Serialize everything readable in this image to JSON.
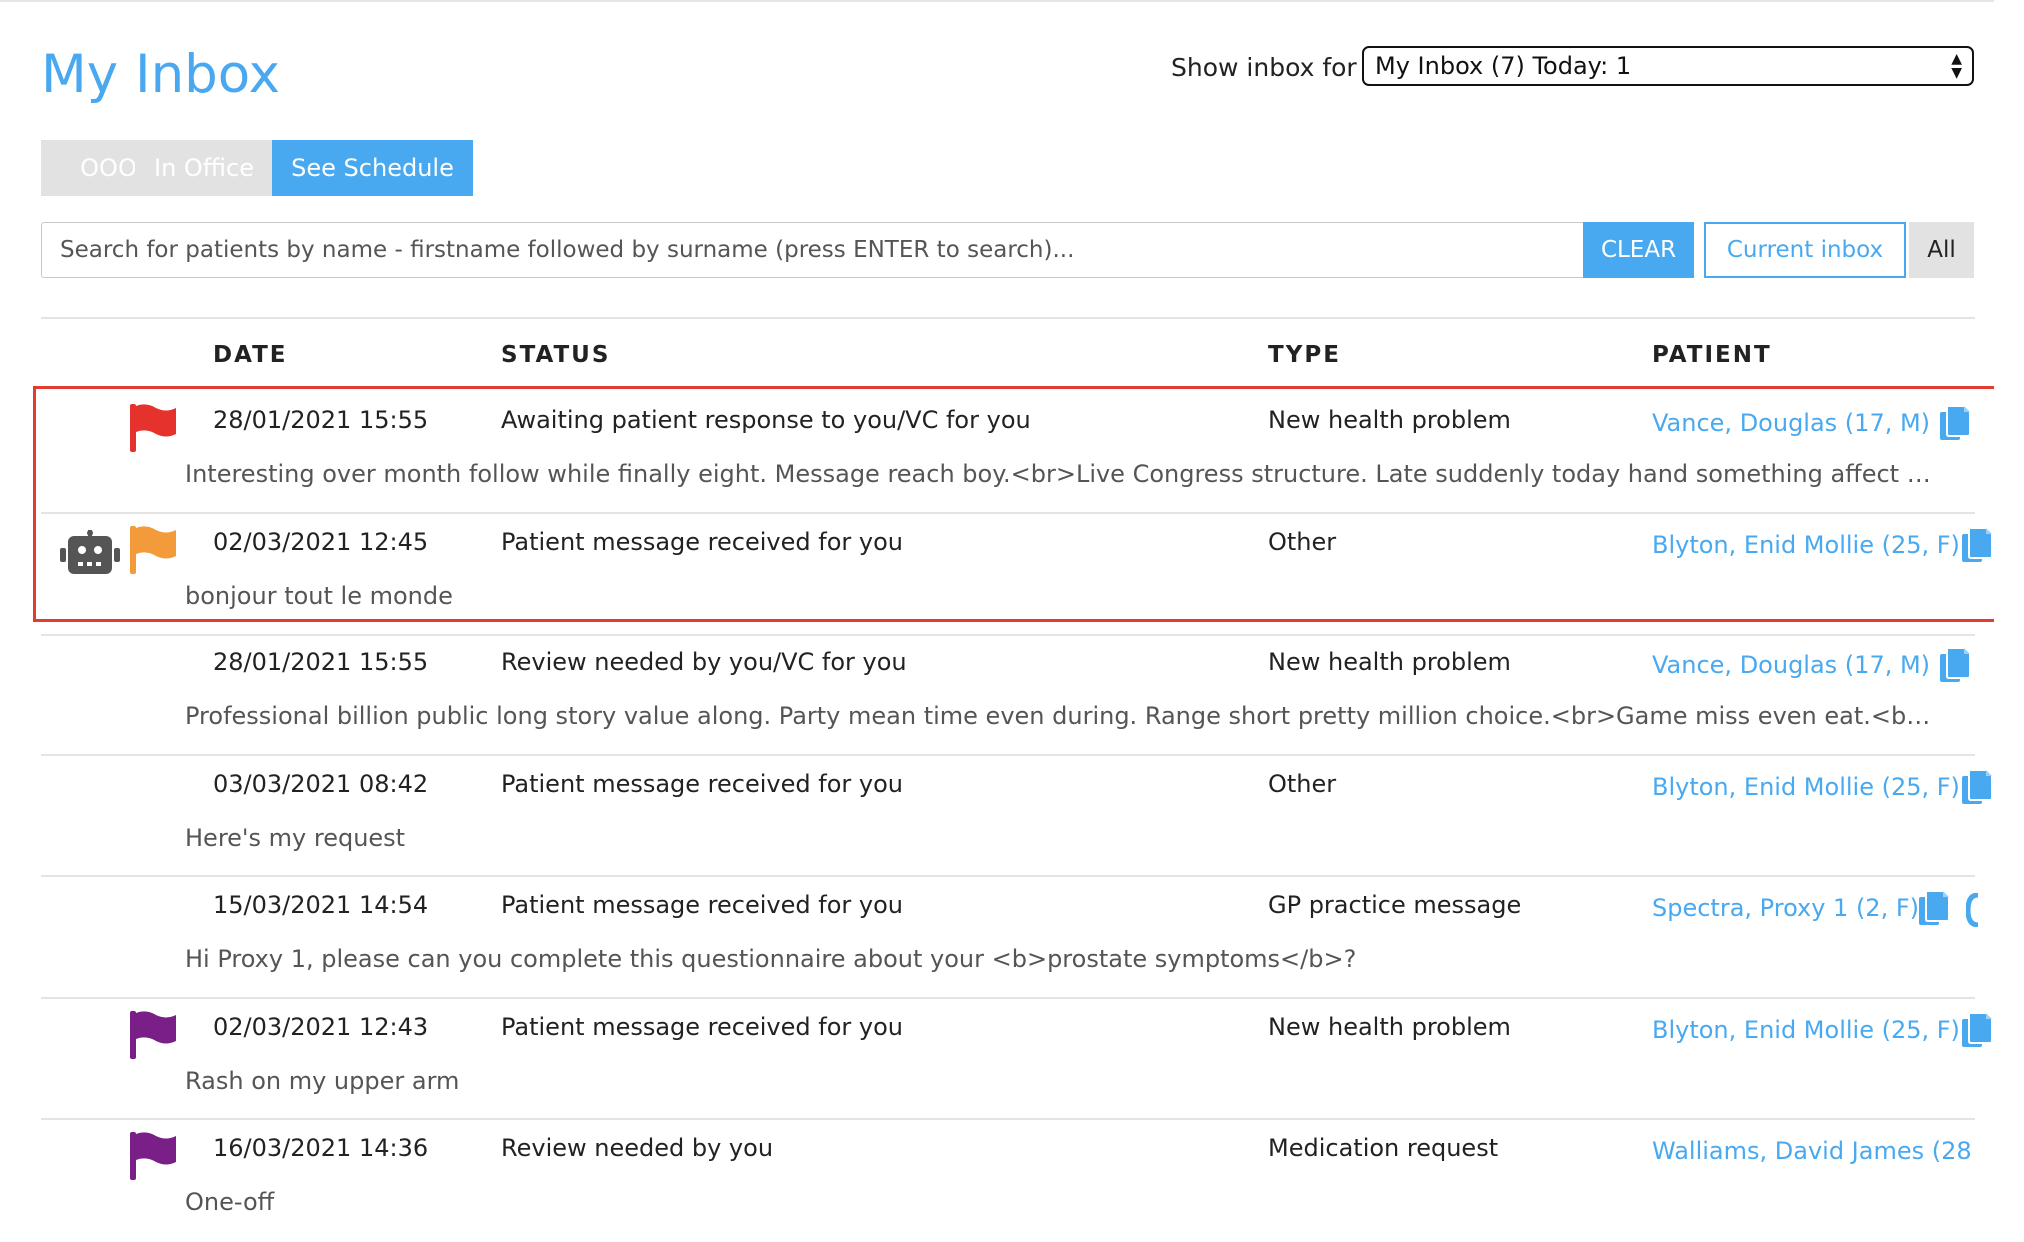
{
  "header": {
    "title": "My Inbox",
    "show_inbox_label": "Show inbox for",
    "inbox_selected": "My Inbox (7) Today: 1"
  },
  "availability": {
    "options": [
      "OOO",
      "In Office",
      "See Schedule"
    ],
    "active": "See Schedule"
  },
  "search": {
    "placeholder": "Search for patients by name - firstname followed by surname (press ENTER to search)...",
    "clear_label": "CLEAR",
    "current_inbox_label": "Current inbox",
    "all_label": "All"
  },
  "table": {
    "columns": [
      "DATE",
      "STATUS",
      "TYPE",
      "PATIENT"
    ],
    "rows": [
      {
        "date": "28/01/2021 15:55",
        "status": "Awaiting patient response to you/VC for you",
        "type": "New health problem",
        "patient": "Vance, Douglas (17, M)",
        "message": "Interesting over month follow while finally eight. Message reach boy.<br>Live Congress structure. Late suddenly today hand something affect abo...",
        "flag": "red",
        "robot": false,
        "highlighted": true
      },
      {
        "date": "02/03/2021 12:45",
        "status": "Patient message received for you",
        "type": "Other",
        "patient": "Blyton, Enid Mollie (25, F)",
        "message": "bonjour tout le monde",
        "flag": "orange",
        "robot": true,
        "highlighted": true
      },
      {
        "date": "28/01/2021 15:55",
        "status": "Review needed by you/VC for you",
        "type": "New health problem",
        "patient": "Vance, Douglas (17, M)",
        "message": "Professional billion public long story value along. Party mean time even during. Range short pretty million choice.<br>Game miss even eat.<br>Da...",
        "flag": null,
        "robot": false,
        "highlighted": false
      },
      {
        "date": "03/03/2021 08:42",
        "status": "Patient message received for you",
        "type": "Other",
        "patient": "Blyton, Enid Mollie (25, F)",
        "message": "Here's my request",
        "flag": null,
        "robot": false,
        "highlighted": false
      },
      {
        "date": "15/03/2021 14:54",
        "status": "Patient message received for you",
        "type": "GP practice message",
        "patient": "Spectra, Proxy 1 (2, F)",
        "message": "Hi Proxy 1, please can you complete this questionnaire about your <b>prostate symptoms</b>?",
        "flag": null,
        "robot": false,
        "highlighted": false
      },
      {
        "date": "02/03/2021 12:43",
        "status": "Patient message received for you",
        "type": "New health problem",
        "patient": "Blyton, Enid Mollie (25, F)",
        "message": "Rash on my upper arm",
        "flag": "purple",
        "robot": false,
        "highlighted": false
      },
      {
        "date": "16/03/2021 14:36",
        "status": "Review needed by you",
        "type": "Medication request",
        "patient": "Walliams, David James (28",
        "message": "One-off",
        "flag": "purple",
        "robot": false,
        "highlighted": false
      }
    ]
  },
  "colors": {
    "accent": "#48a9f0",
    "flag_red": "#e5322d",
    "flag_orange": "#f39a3a",
    "flag_purple": "#7a1f87",
    "highlight_border": "#e03c31"
  }
}
